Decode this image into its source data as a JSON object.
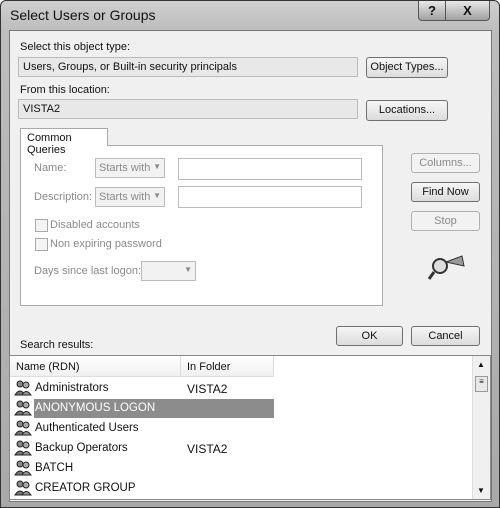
{
  "window": {
    "title": "Select Users or Groups",
    "help": "?",
    "close": "X"
  },
  "object_type": {
    "label": "Select this object type:",
    "value": "Users, Groups, or Built-in security principals",
    "button": "Object Types..."
  },
  "location": {
    "label": "From this location:",
    "value": "VISTA2",
    "button": "Locations..."
  },
  "queries": {
    "tab": "Common Queries",
    "name_label": "Name:",
    "name_mode": "Starts with",
    "name_value": "",
    "desc_label": "Description:",
    "desc_mode": "Starts with",
    "desc_value": "",
    "disabled_accounts": "Disabled accounts",
    "non_expiring": "Non expiring password",
    "days_label": "Days since last logon:",
    "days_value": ""
  },
  "side_buttons": {
    "columns": "Columns...",
    "find_now": "Find Now",
    "stop": "Stop"
  },
  "ok": "OK",
  "cancel": "Cancel",
  "results": {
    "label": "Search results:",
    "columns": [
      "Name (RDN)",
      "In Folder"
    ],
    "rows": [
      {
        "name": "Administrators",
        "folder": "VISTA2"
      },
      {
        "name": "ANONYMOUS LOGON",
        "folder": ""
      },
      {
        "name": "Authenticated Users",
        "folder": ""
      },
      {
        "name": "Backup Operators",
        "folder": "VISTA2"
      },
      {
        "name": "BATCH",
        "folder": ""
      },
      {
        "name": "CREATOR GROUP",
        "folder": ""
      }
    ],
    "selected_index": 1
  }
}
